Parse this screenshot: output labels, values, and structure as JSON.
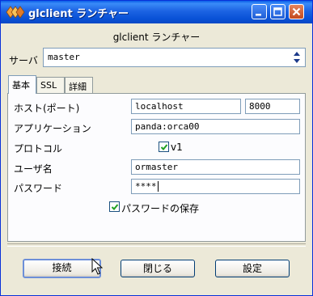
{
  "window": {
    "title": "glclient ランチャー"
  },
  "heading": "glclient ランチャー",
  "server": {
    "label": "サーバ",
    "value": "master"
  },
  "tabs": [
    {
      "label": "基本",
      "active": true
    },
    {
      "label": "SSL",
      "active": false
    },
    {
      "label": "詳細",
      "active": false
    }
  ],
  "form": {
    "host_label": "ホスト(ポート)",
    "host_value": "localhost",
    "port_value": "8000",
    "app_label": "アプリケーション",
    "app_value": "panda:orca00",
    "protocol_label": "プロトコル",
    "protocol_option": "v1",
    "protocol_checked": true,
    "user_label": "ユーザ名",
    "user_value": "ormaster",
    "password_label": "パスワード",
    "password_value": "****",
    "save_password_label": "パスワードの保存",
    "save_password_checked": true
  },
  "buttons": {
    "connect": "接続",
    "close": "閉じる",
    "settings": "設定"
  },
  "colors": {
    "titlebar": "#0a5ee8",
    "face": "#ece9d8",
    "check": "#21a121"
  }
}
